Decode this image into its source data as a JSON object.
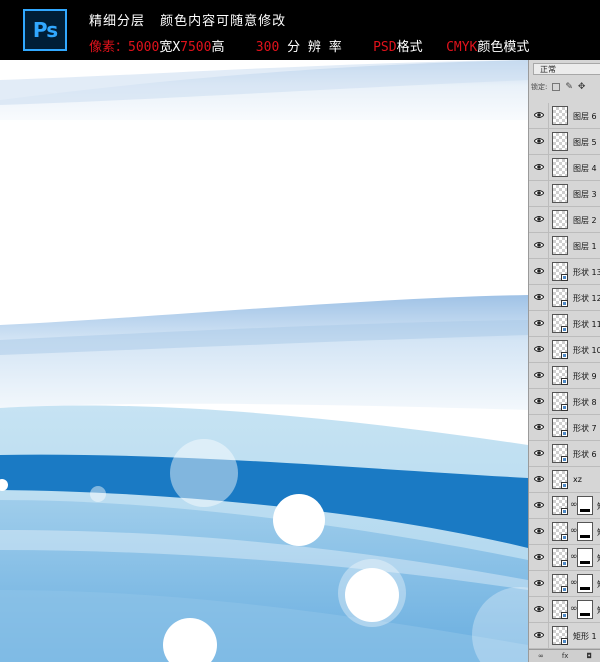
{
  "banner": {
    "logo_text": "Ps",
    "line1": [
      "精细分层",
      "颜色内容可随意修改"
    ],
    "pixels_label": "像素：",
    "pixels_w": "5000",
    "pixels_sep": "宽X",
    "pixels_h": "7500",
    "pixels_unit": "高",
    "resolution_value": "300",
    "resolution_label": " 分 辨 率",
    "format_value": "PSD",
    "format_label": "格式",
    "color_value": "CMYK",
    "color_label": "颜色模式"
  },
  "layers_panel": {
    "blend_mode": "正常",
    "lock_label": "锁定:",
    "layers": [
      {
        "name": "图层 6",
        "type": "pixel"
      },
      {
        "name": "图层 5",
        "type": "pixel"
      },
      {
        "name": "图层 4",
        "type": "pixel"
      },
      {
        "name": "图层 3",
        "type": "pixel"
      },
      {
        "name": "图层 2",
        "type": "pixel"
      },
      {
        "name": "图层 1",
        "type": "pixel"
      },
      {
        "name": "形状 13",
        "type": "shape"
      },
      {
        "name": "形状 12",
        "type": "shape"
      },
      {
        "name": "形状 11",
        "type": "shape"
      },
      {
        "name": "形状 10",
        "type": "shape"
      },
      {
        "name": "形状 9",
        "type": "shape"
      },
      {
        "name": "形状 8",
        "type": "shape"
      },
      {
        "name": "形状 7",
        "type": "shape"
      },
      {
        "name": "形状 6",
        "type": "shape"
      },
      {
        "name": "xz",
        "type": "shape"
      },
      {
        "name": "矩",
        "type": "masked"
      },
      {
        "name": "矩",
        "type": "masked"
      },
      {
        "name": "矩",
        "type": "masked"
      },
      {
        "name": "矩",
        "type": "masked"
      },
      {
        "name": "矩",
        "type": "masked"
      },
      {
        "name": "矩形 1",
        "type": "shape"
      }
    ],
    "footer_icons": [
      "link-icon",
      "fx-icon",
      "mask-icon"
    ],
    "footer_labels": [
      "∞",
      "fx",
      "◘"
    ]
  },
  "colors": {
    "banner_bg": "#000000",
    "accent_red": "#e0121b",
    "ps_blue": "#31a8ff",
    "wave_dark": "#1a7ac4",
    "wave_light": "#bfe0f2"
  }
}
